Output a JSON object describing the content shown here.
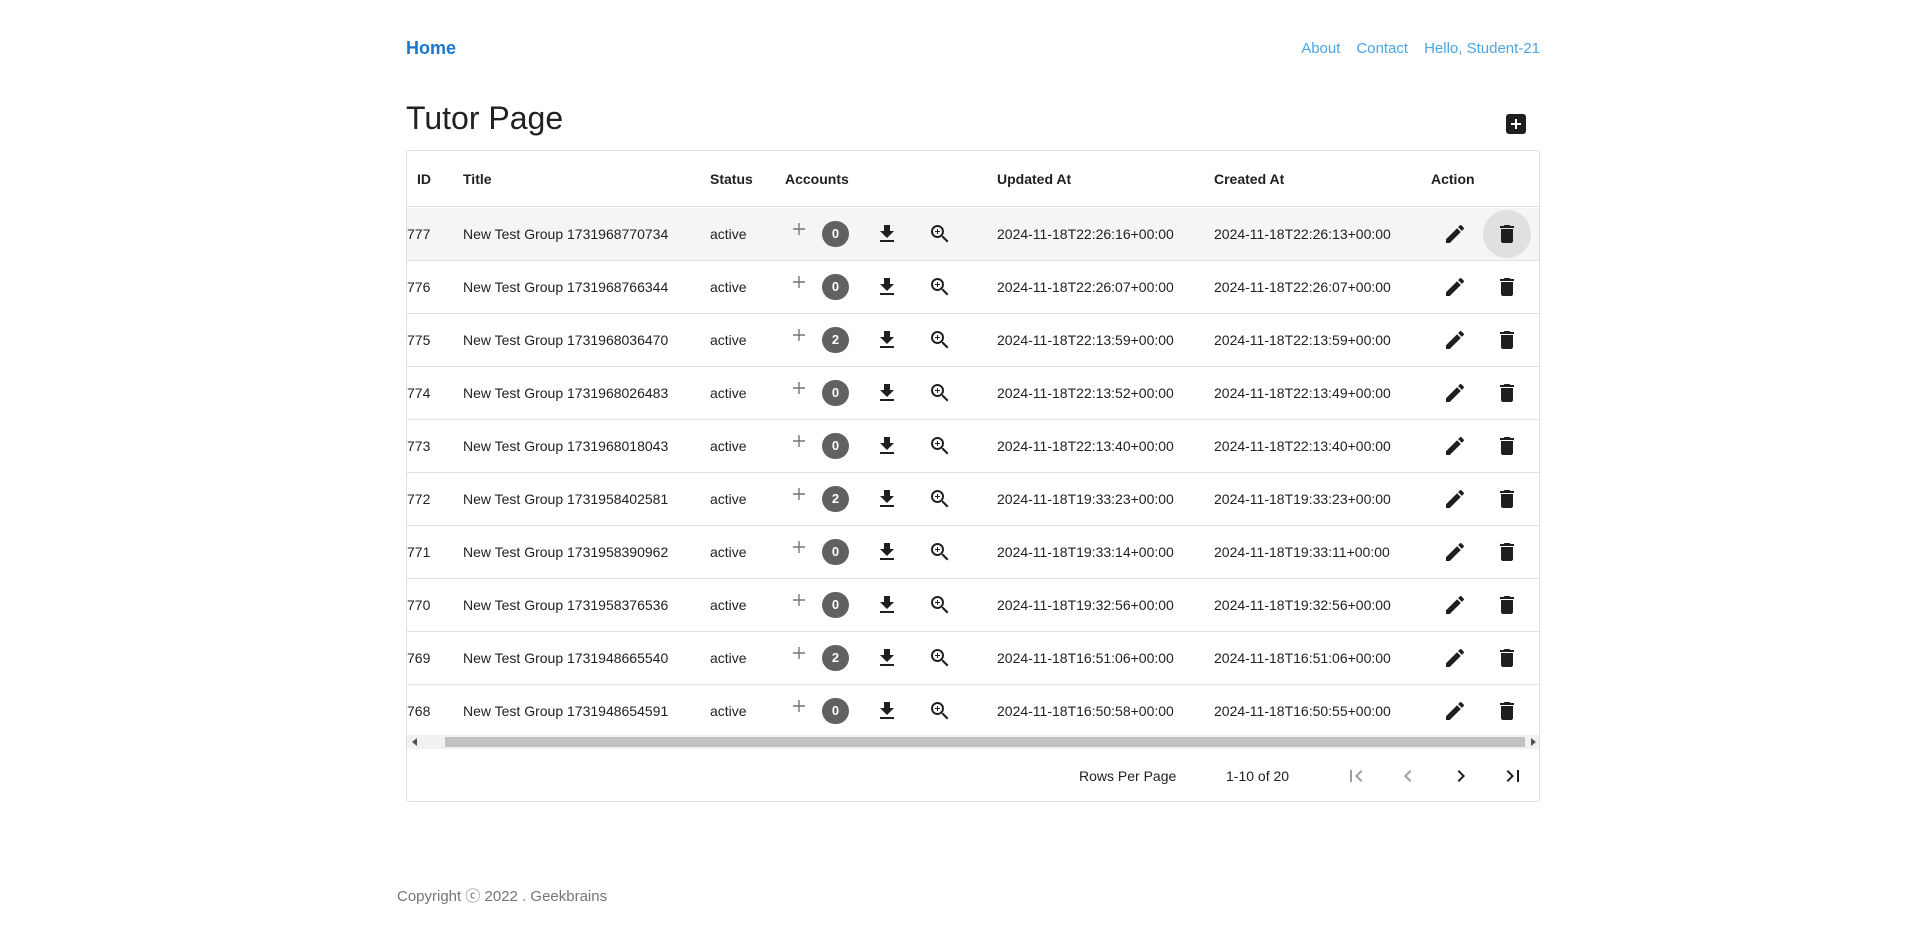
{
  "nav": {
    "home": "Home",
    "links": [
      "About",
      "Contact",
      "Hello, Student-21"
    ]
  },
  "page": {
    "title": "Tutor Page"
  },
  "table": {
    "headers": {
      "id": "ID",
      "title": "Title",
      "status": "Status",
      "accounts": "Accounts",
      "updated": "Updated At",
      "created": "Created At",
      "action": "Action"
    },
    "rows": [
      {
        "id": "777",
        "title": "New Test Group 1731968770734",
        "status": "active",
        "accounts": "0",
        "updated": "2024-11-18T22:26:16+00:00",
        "created": "2024-11-18T22:26:13+00:00"
      },
      {
        "id": "776",
        "title": "New Test Group 1731968766344",
        "status": "active",
        "accounts": "0",
        "updated": "2024-11-18T22:26:07+00:00",
        "created": "2024-11-18T22:26:07+00:00"
      },
      {
        "id": "775",
        "title": "New Test Group 1731968036470",
        "status": "active",
        "accounts": "2",
        "updated": "2024-11-18T22:13:59+00:00",
        "created": "2024-11-18T22:13:59+00:00"
      },
      {
        "id": "774",
        "title": "New Test Group 1731968026483",
        "status": "active",
        "accounts": "0",
        "updated": "2024-11-18T22:13:52+00:00",
        "created": "2024-11-18T22:13:49+00:00"
      },
      {
        "id": "773",
        "title": "New Test Group 1731968018043",
        "status": "active",
        "accounts": "0",
        "updated": "2024-11-18T22:13:40+00:00",
        "created": "2024-11-18T22:13:40+00:00"
      },
      {
        "id": "772",
        "title": "New Test Group 1731958402581",
        "status": "active",
        "accounts": "2",
        "updated": "2024-11-18T19:33:23+00:00",
        "created": "2024-11-18T19:33:23+00:00"
      },
      {
        "id": "771",
        "title": "New Test Group 1731958390962",
        "status": "active",
        "accounts": "0",
        "updated": "2024-11-18T19:33:14+00:00",
        "created": "2024-11-18T19:33:11+00:00"
      },
      {
        "id": "770",
        "title": "New Test Group 1731958376536",
        "status": "active",
        "accounts": "0",
        "updated": "2024-11-18T19:32:56+00:00",
        "created": "2024-11-18T19:32:56+00:00"
      },
      {
        "id": "769",
        "title": "New Test Group 1731948665540",
        "status": "active",
        "accounts": "2",
        "updated": "2024-11-18T16:51:06+00:00",
        "created": "2024-11-18T16:51:06+00:00"
      },
      {
        "id": "768",
        "title": "New Test Group 1731948654591",
        "status": "active",
        "accounts": "0",
        "updated": "2024-11-18T16:50:58+00:00",
        "created": "2024-11-18T16:50:55+00:00"
      }
    ]
  },
  "pagination": {
    "rows_per_page_label": "Rows Per Page",
    "range": "1-10 of 20"
  },
  "footer": {
    "copyright": "Copyright ⓒ 2022 . Geekbrains"
  },
  "colors": {
    "link": "#1976d2",
    "nav_link": "#4aa6e0",
    "badge": "#616161"
  }
}
